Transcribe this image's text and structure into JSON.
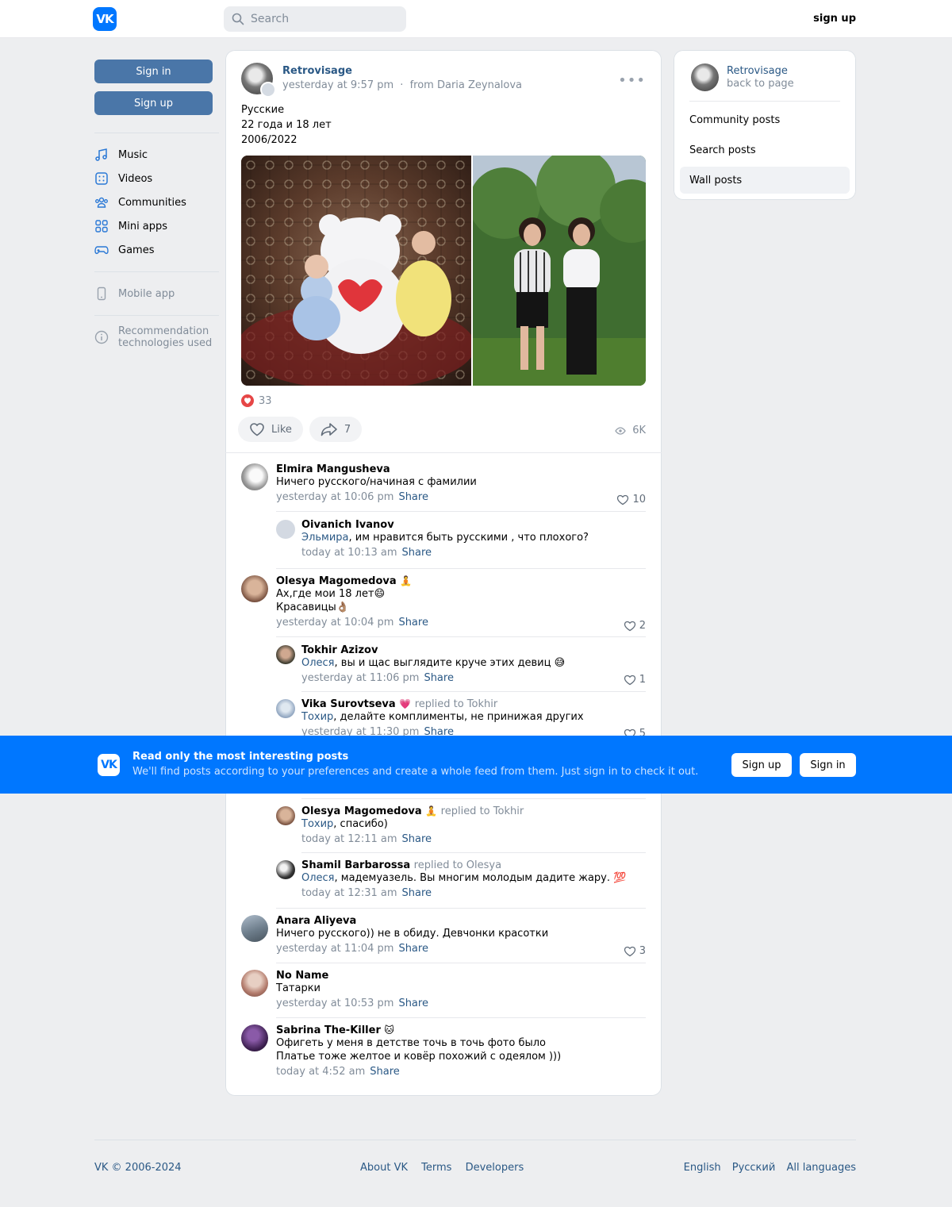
{
  "header": {
    "logo_text": "VK",
    "search_placeholder": "Search",
    "signup_label": "sign up"
  },
  "sidebar": {
    "sign_in_label": "Sign in",
    "sign_up_label": "Sign up",
    "items": [
      {
        "label": "Music",
        "icon": "music-icon"
      },
      {
        "label": "Videos",
        "icon": "videos-icon"
      },
      {
        "label": "Communities",
        "icon": "communities-icon"
      },
      {
        "label": "Mini apps",
        "icon": "mini-apps-icon"
      },
      {
        "label": "Games",
        "icon": "games-icon"
      }
    ],
    "mobile_app": "Mobile app",
    "recommendation_line1": "Recommendation",
    "recommendation_line2": "technologies used"
  },
  "post": {
    "author": "Retrovisage",
    "time": "yesterday at 9:57 pm",
    "separator": "·",
    "from": "from Daria Zeynalova",
    "text_lines": [
      "Русские",
      "22 года и 18 лет",
      "2006/2022"
    ],
    "reactions_count": "33",
    "like_label": "Like",
    "share_count": "7",
    "views": "6K"
  },
  "comments": [
    {
      "name": "Elmira Mangusheva",
      "badge": "",
      "replied": "",
      "mention": "",
      "text": "Ничего русского/начиная с фамилии",
      "text2": "",
      "time": "yesterday at 10:06 pm",
      "share": "Share",
      "likes": "10"
    },
    {
      "name": "Oivanich Ivanov",
      "badge": "",
      "replied": "",
      "mention": "Эльмира",
      "text": ", им нравится быть русскими , что плохого?",
      "text2": "",
      "time": "today at 10:13 am",
      "share": "Share",
      "likes": ""
    },
    {
      "name": "Olesya Magomedova",
      "badge": "🧘",
      "replied": "",
      "mention": "",
      "text": "Ах,где мои 18 лет😄",
      "text2": "Красавицы👌🏽",
      "time": "yesterday at 10:04 pm",
      "share": "Share",
      "likes": "2"
    },
    {
      "name": "Tokhir Azizov",
      "badge": "",
      "replied": "",
      "mention": "Олеся",
      "text": ", вы и щас выглядите круче этих девиц 😅",
      "text2": "",
      "time": "yesterday at 11:06 pm",
      "share": "Share",
      "likes": "1"
    },
    {
      "name": "Vika Surovtseva",
      "badge": "💗",
      "replied": "replied to Tokhir",
      "mention": "Тохир",
      "text": ", делайте комплименты, не принижая других",
      "text2": "",
      "time": "yesterday at 11:30 pm",
      "share": "Share",
      "likes": "5"
    },
    {
      "name": "Olesya Magomedova",
      "badge": "🧘",
      "replied": "replied to Tokhir",
      "mention": "Тохир",
      "text": ", спасибо)",
      "text2": "",
      "time": "today at 12:11 am",
      "share": "Share",
      "likes": ""
    },
    {
      "name": "Shamil Barbarossa",
      "badge": "",
      "replied": "replied to Olesya",
      "mention": "Олеся",
      "text": ", мадемуазель. Вы многим молодым дадите жару. 💯",
      "text2": "",
      "time": "today at 12:31 am",
      "share": "Share",
      "likes": ""
    },
    {
      "name": "Anara Aliyeva",
      "badge": "",
      "replied": "",
      "mention": "",
      "text": "Ничего русского)) не в обиду. Девчонки красотки",
      "text2": "",
      "time": "yesterday at 11:04 pm",
      "share": "Share",
      "likes": "3"
    },
    {
      "name": "No Name",
      "badge": "",
      "replied": "",
      "mention": "",
      "text": "Татарки",
      "text2": "",
      "time": "yesterday at 10:53 pm",
      "share": "Share",
      "likes": ""
    },
    {
      "name": "Sabrina The-Killer",
      "badge": "🐱",
      "replied": "",
      "mention": "",
      "text": "Офигеть у меня в детстве точь в точь фото было",
      "text2": "Платье тоже желтое и ковёр похожий с одеялом )))",
      "time": "today at 4:52 am",
      "share": "Share",
      "likes": ""
    }
  ],
  "right": {
    "author": "Retrovisage",
    "back": "back to page",
    "items": [
      "Community posts",
      "Search posts",
      "Wall posts"
    ]
  },
  "banner": {
    "logo_text": "VK",
    "title": "Read only the most interesting posts",
    "subtitle": "We'll find posts according to your preferences and create a whole feed from them. Just sign in to check it out.",
    "signup": "Sign up",
    "signin": "Sign in"
  },
  "footer": {
    "copyright": "VK © 2006-2024",
    "links": [
      "About VK",
      "Terms",
      "Developers"
    ],
    "languages": [
      "English",
      "Русский",
      "All languages"
    ]
  },
  "colors": {
    "accent": "#0077ff",
    "link": "#2a5885",
    "button": "#4a76a8",
    "background": "#edeef0",
    "like_red": "#e64646"
  }
}
